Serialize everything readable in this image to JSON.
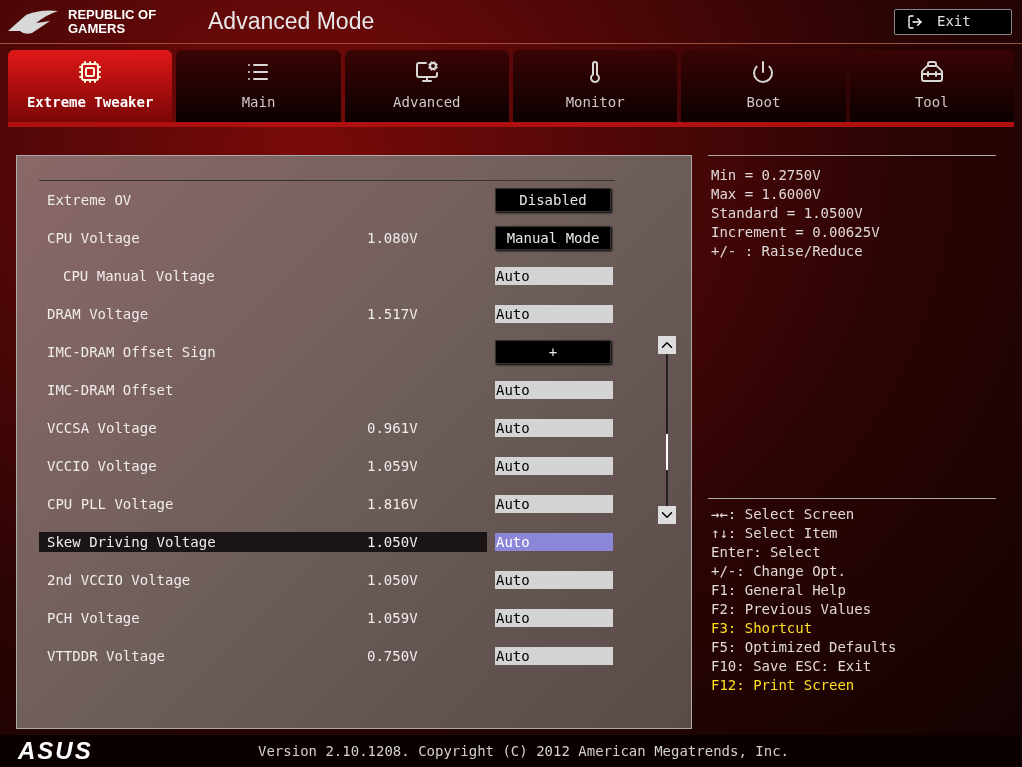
{
  "header": {
    "brand": "REPUBLIC OF GAMERS",
    "title": "Advanced Mode",
    "exit_button": "Exit"
  },
  "tabs": [
    {
      "label": "Extreme Tweaker",
      "kind": "tweaker",
      "selected": true
    },
    {
      "label": "Main",
      "kind": "list",
      "selected": false
    },
    {
      "label": "Advanced",
      "kind": "advanced",
      "selected": false
    },
    {
      "label": "Monitor",
      "kind": "monitor",
      "selected": false
    },
    {
      "label": "Boot",
      "kind": "power",
      "selected": false
    },
    {
      "label": "Tool",
      "kind": "tool",
      "selected": false
    }
  ],
  "settings": [
    {
      "label": "Extreme OV",
      "kind": "select",
      "value": "Disabled",
      "selected": false
    },
    {
      "label": "CPU Voltage",
      "reading": "1.080V",
      "kind": "select",
      "value": "Manual Mode",
      "selected": false,
      "children": [
        {
          "label": "CPU Manual Voltage",
          "kind": "input",
          "value": "Auto",
          "selected": false
        }
      ]
    },
    {
      "label": "DRAM Voltage",
      "reading": "1.517V",
      "kind": "input",
      "value": "Auto",
      "selected": false
    },
    {
      "label": "IMC-DRAM Offset Sign",
      "kind": "select",
      "value": "+",
      "selected": false
    },
    {
      "label": "IMC-DRAM Offset",
      "kind": "input",
      "value": "Auto",
      "selected": false
    },
    {
      "label": "VCCSA Voltage",
      "reading": "0.961V",
      "kind": "input",
      "value": "Auto",
      "selected": false
    },
    {
      "label": "VCCIO Voltage",
      "reading": "1.059V",
      "kind": "input",
      "value": "Auto",
      "selected": false
    },
    {
      "label": "CPU PLL Voltage",
      "reading": "1.816V",
      "kind": "input",
      "value": "Auto",
      "selected": false
    },
    {
      "label": "Skew Driving Voltage",
      "reading": "1.050V",
      "kind": "input",
      "value": "Auto",
      "selected": true
    },
    {
      "label": "2nd VCCIO Voltage",
      "reading": "1.050V",
      "kind": "input",
      "value": "Auto",
      "selected": false
    },
    {
      "label": "PCH Voltage",
      "reading": "1.059V",
      "kind": "input",
      "value": "Auto",
      "selected": false
    },
    {
      "label": "VTTDDR Voltage",
      "reading": "0.750V",
      "kind": "input",
      "value": "Auto",
      "selected": false
    }
  ],
  "help": [
    "Min = 0.2750V",
    "Max = 1.6000V",
    "Standard = 1.0500V",
    "Increment = 0.00625V",
    "+/- : Raise/Reduce"
  ],
  "keys": [
    {
      "text": "→←: Select Screen",
      "highlighted": false
    },
    {
      "text": "↑↓: Select Item",
      "highlighted": false
    },
    {
      "text": "Enter: Select",
      "highlighted": false
    },
    {
      "text": "+/-: Change Opt.",
      "highlighted": false
    },
    {
      "text": "F1: General Help",
      "highlighted": false
    },
    {
      "text": "F2: Previous Values",
      "highlighted": false
    },
    {
      "text": "F3: Shortcut",
      "highlighted": true
    },
    {
      "text": "F5: Optimized Defaults",
      "highlighted": false
    },
    {
      "text": "F10: Save  ESC: Exit",
      "highlighted": false
    },
    {
      "text": "F12: Print Screen",
      "highlighted": true
    }
  ],
  "footer": {
    "logo": "ASUS",
    "version": "Version 2.10.1208. Copyright (C) 2012 American Megatrends, Inc."
  }
}
